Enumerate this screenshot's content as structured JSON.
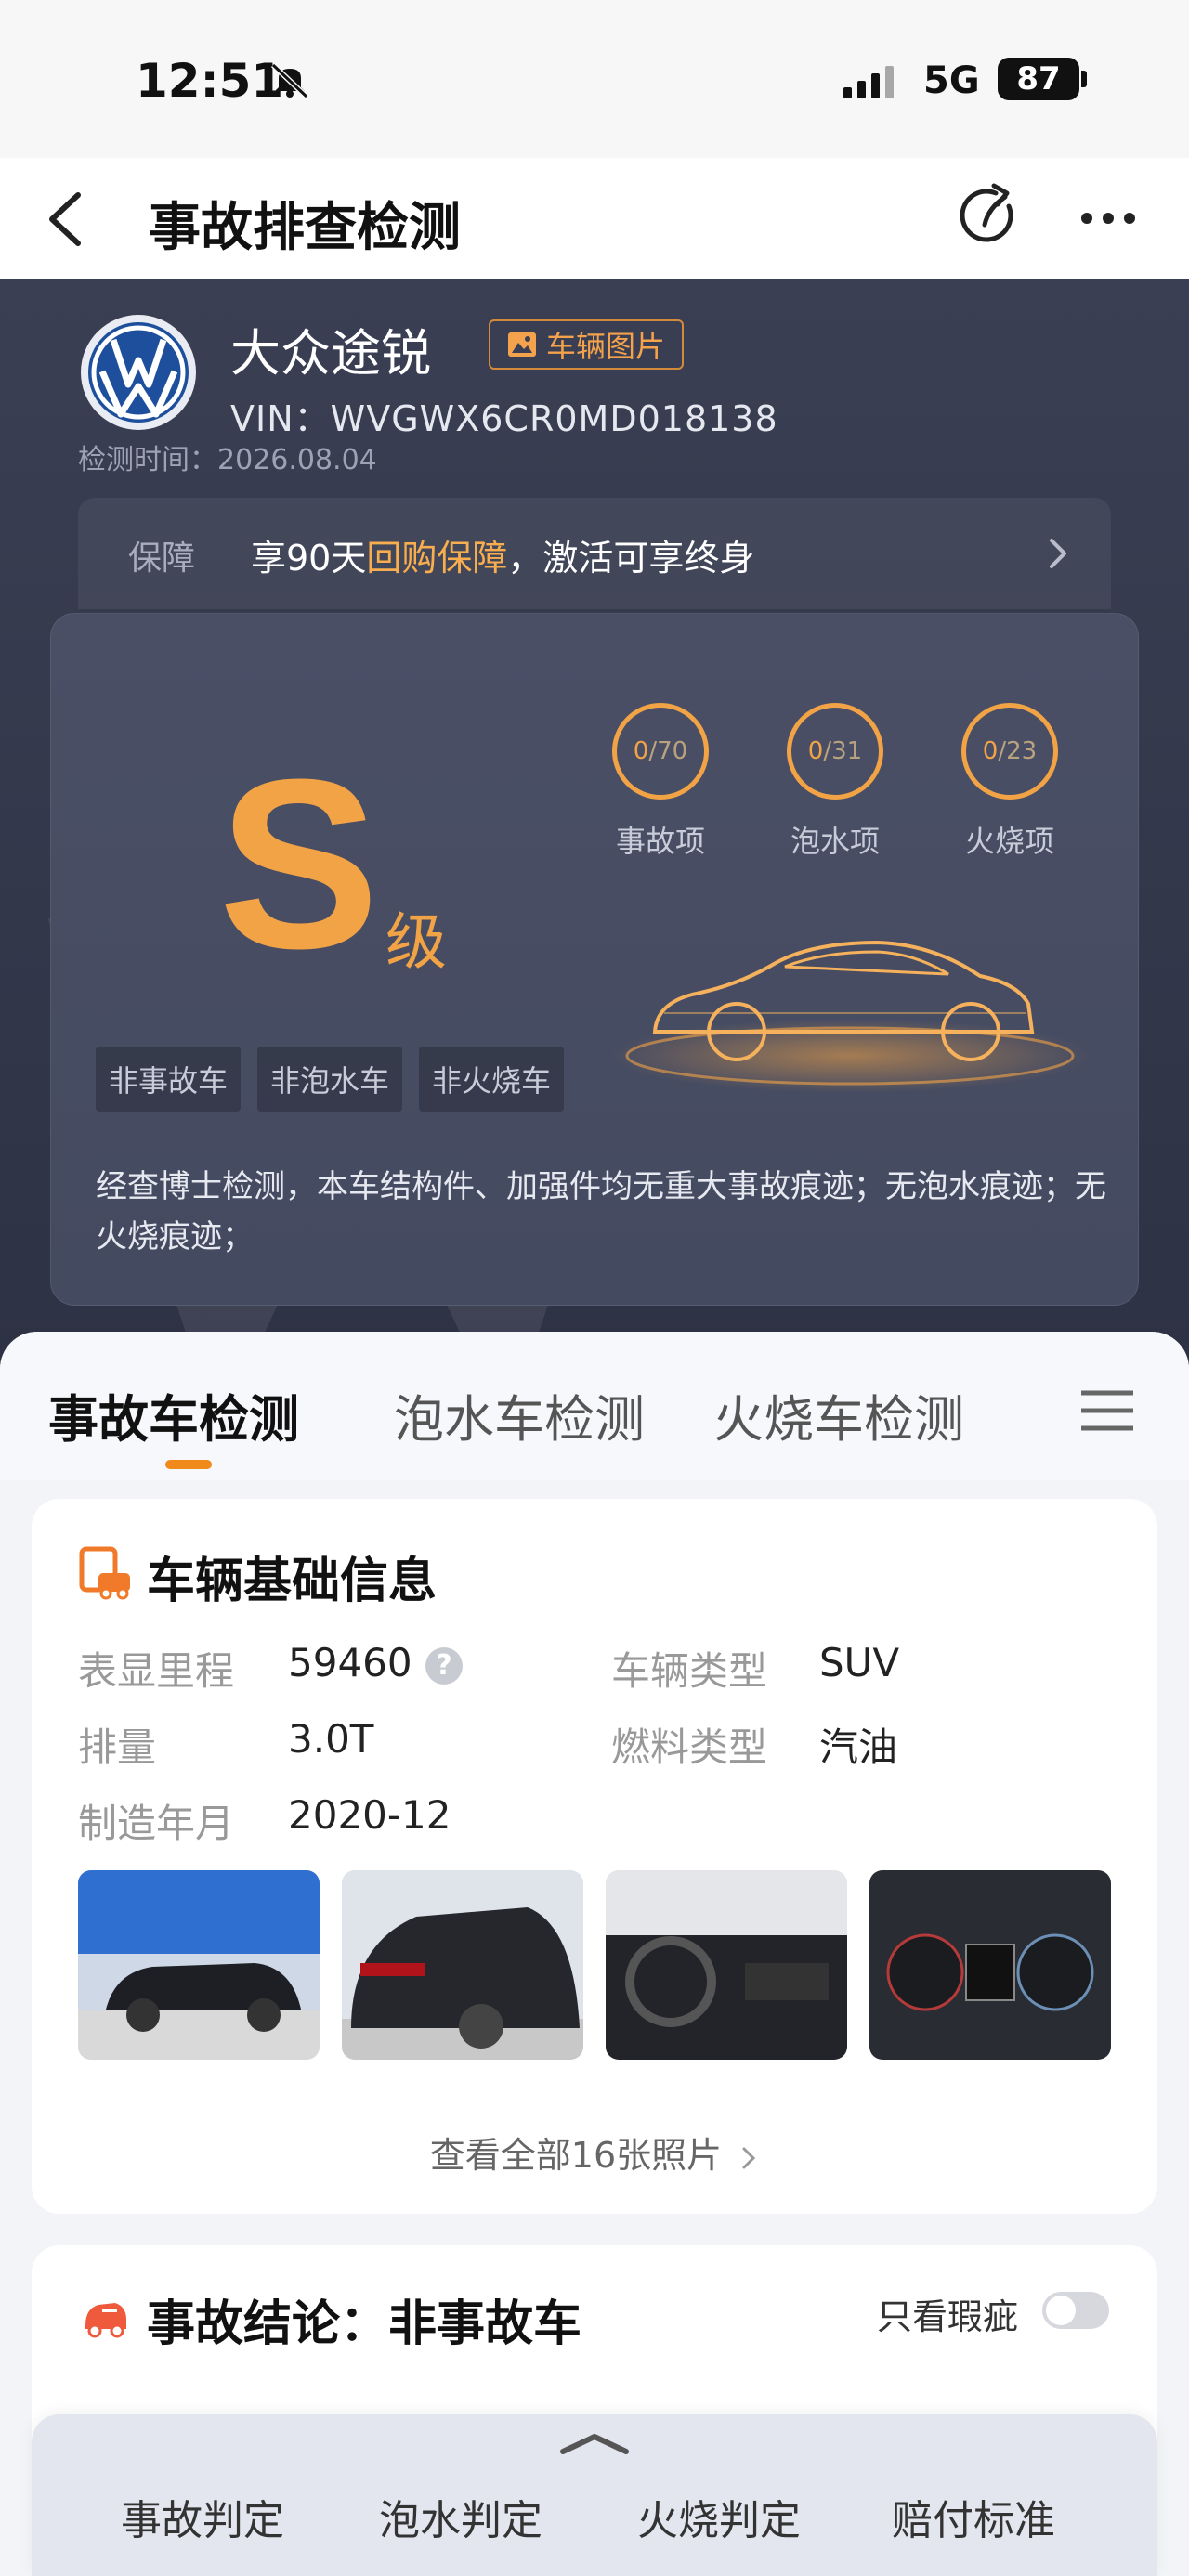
{
  "status_bar": {
    "time": "12:51",
    "network": "5G",
    "battery": "87"
  },
  "header": {
    "title": "事故排查检测"
  },
  "vehicle": {
    "name": "大众途锐",
    "photo_tag": "车辆图片",
    "vin": "VIN：WVGWX6CR0MD018138",
    "check_time": "检测时间：2026.08.04"
  },
  "guarantee": {
    "label": "保障",
    "text_before": "享90天",
    "highlight": "回购保障",
    "text_after": "，激活可享终身"
  },
  "grade": {
    "letter": "S",
    "unit": "级",
    "rings": [
      {
        "num": "0",
        "den": "/70",
        "label": "事故项"
      },
      {
        "num": "0",
        "den": "/31",
        "label": "泡水项"
      },
      {
        "num": "0",
        "den": "/23",
        "label": "火烧项"
      }
    ],
    "tags": [
      "非事故车",
      "非泡水车",
      "非火烧车"
    ],
    "summary": "经查博士检测，本车结构件、加强件均无重大事故痕迹；无泡水痕迹；无火烧痕迹；"
  },
  "tabs": [
    "事故车检测",
    "泡水车检测",
    "火烧车检测"
  ],
  "basic_info": {
    "title": "车辆基础信息",
    "fields": [
      {
        "label": "表显里程",
        "value": "59460"
      },
      {
        "label": "车辆类型",
        "value": "SUV"
      },
      {
        "label": "排量",
        "value": "3.0T"
      },
      {
        "label": "燃料类型",
        "value": "汽油"
      },
      {
        "label": "制造年月",
        "value": "2020-12"
      }
    ],
    "view_all": "查看全部16张照片"
  },
  "conclusion": {
    "title": "事故结论：非事故车",
    "toggle_label": "只看瑕疵"
  },
  "bottom_nav": [
    "事故判定",
    "泡水判定",
    "火烧判定",
    "赔付标准"
  ],
  "colors": {
    "accent": "#f1a346",
    "tab_indicator": "#f08a1a",
    "hero_bg": "#3b3f53"
  }
}
